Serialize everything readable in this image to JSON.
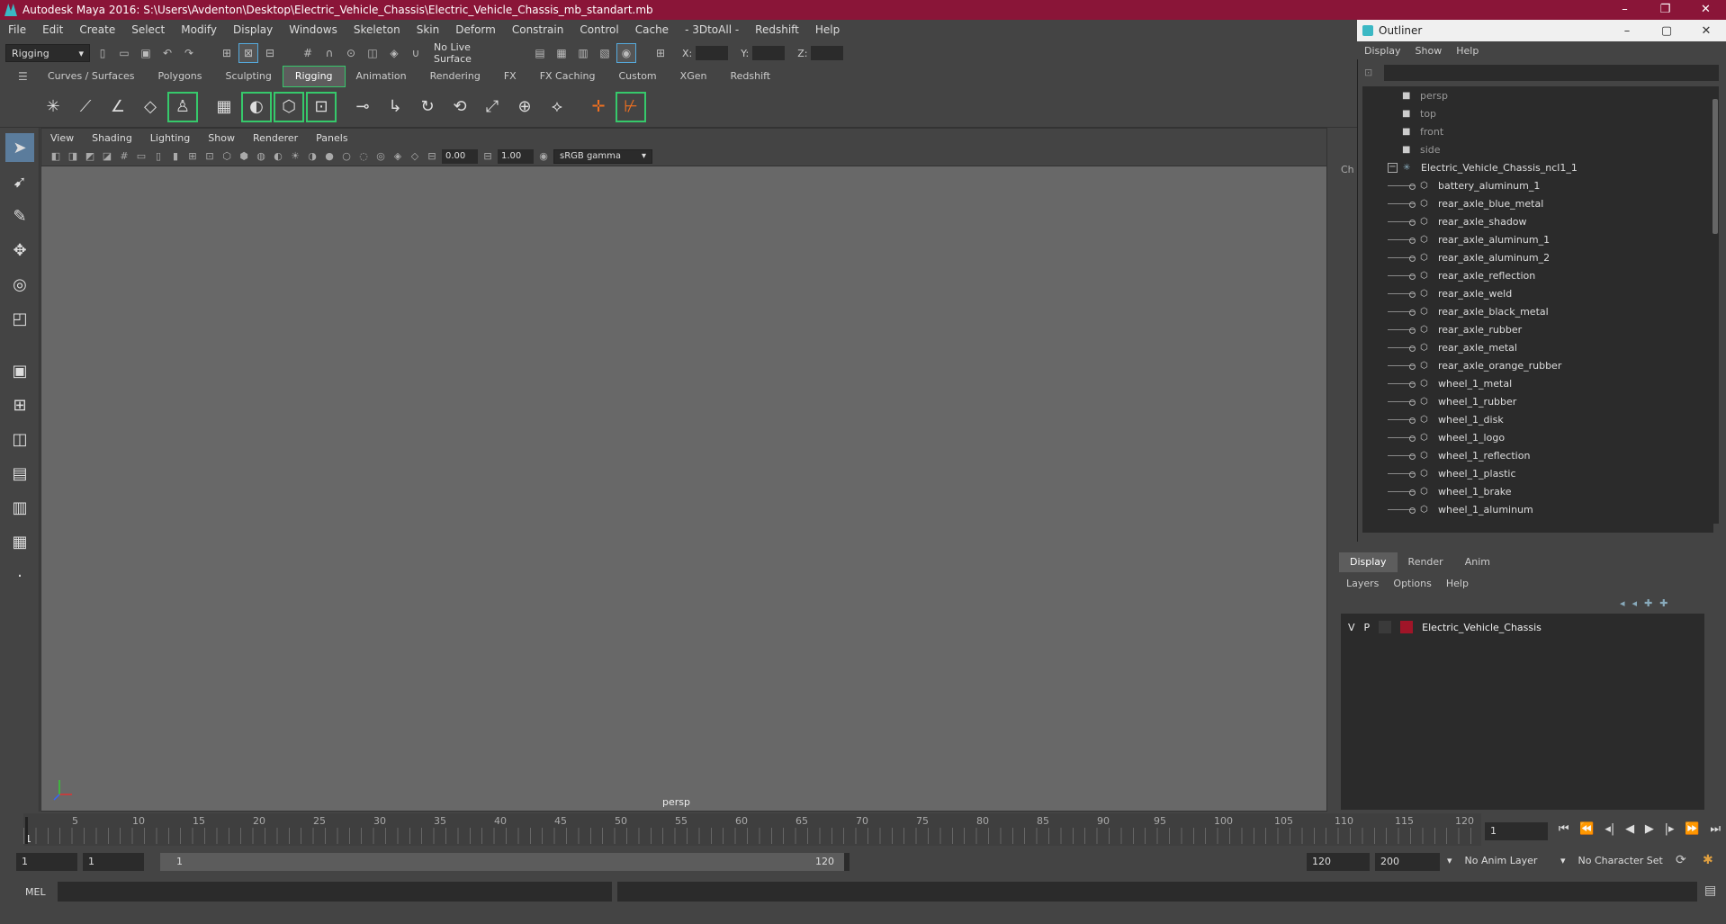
{
  "window": {
    "title": "Autodesk Maya 2016: S:\\Users\\Avdenton\\Desktop\\Electric_Vehicle_Chassis\\Electric_Vehicle_Chassis_mb_standart.mb"
  },
  "menu": [
    "File",
    "Edit",
    "Create",
    "Select",
    "Modify",
    "Display",
    "Windows",
    "Skeleton",
    "Skin",
    "Deform",
    "Constrain",
    "Control",
    "Cache",
    "- 3DtoAll -",
    "Redshift",
    "Help"
  ],
  "toolbar": {
    "mode": "Rigging",
    "live_surface": "No Live Surface",
    "x": "X:",
    "y": "Y:",
    "z": "Z:"
  },
  "shelf_tabs": [
    "Curves / Surfaces",
    "Polygons",
    "Sculpting",
    "Rigging",
    "Animation",
    "Rendering",
    "FX",
    "FX Caching",
    "Custom",
    "XGen",
    "Redshift"
  ],
  "shelf_active": "Rigging",
  "viewport": {
    "menu": [
      "View",
      "Shading",
      "Lighting",
      "Show",
      "Renderer",
      "Panels"
    ],
    "near": "0.00",
    "far": "1.00",
    "color_space": "sRGB gamma",
    "camera": "persp"
  },
  "outliner": {
    "title": "Outliner",
    "menu": [
      "Display",
      "Show",
      "Help"
    ],
    "cameras": [
      "persp",
      "top",
      "front",
      "side"
    ],
    "group": "Electric_Vehicle_Chassis_ncl1_1",
    "items": [
      "battery_aluminum_1",
      "rear_axle_blue_metal",
      "rear_axle_shadow",
      "rear_axle_aluminum_1",
      "rear_axle_aluminum_2",
      "rear_axle_reflection",
      "rear_axle_weld",
      "rear_axle_black_metal",
      "rear_axle_rubber",
      "rear_axle_metal",
      "rear_axle_orange_rubber",
      "wheel_1_metal",
      "wheel_1_rubber",
      "wheel_1_disk",
      "wheel_1_logo",
      "wheel_1_reflection",
      "wheel_1_plastic",
      "wheel_1_brake",
      "wheel_1_aluminum"
    ]
  },
  "channel_label": "Ch",
  "layers": {
    "tabs": [
      "Display",
      "Render",
      "Anim"
    ],
    "menu": [
      "Layers",
      "Options",
      "Help"
    ],
    "v": "V",
    "p": "P",
    "name": "Electric_Vehicle_Chassis",
    "color": "#a01528"
  },
  "timeline": {
    "ticks": [
      "1",
      "5",
      "10",
      "15",
      "20",
      "25",
      "30",
      "35",
      "40",
      "45",
      "50",
      "55",
      "60",
      "65",
      "70",
      "75",
      "80",
      "85",
      "90",
      "95",
      "100",
      "105",
      "110",
      "115",
      "120"
    ],
    "current": "1"
  },
  "range": {
    "start": "1",
    "start2": "1",
    "slider_start": "1",
    "slider_end": "120",
    "end": "120",
    "end2": "200",
    "anim_layer": "No Anim Layer",
    "char_set": "No Character Set"
  },
  "cmd": {
    "label": "MEL"
  }
}
